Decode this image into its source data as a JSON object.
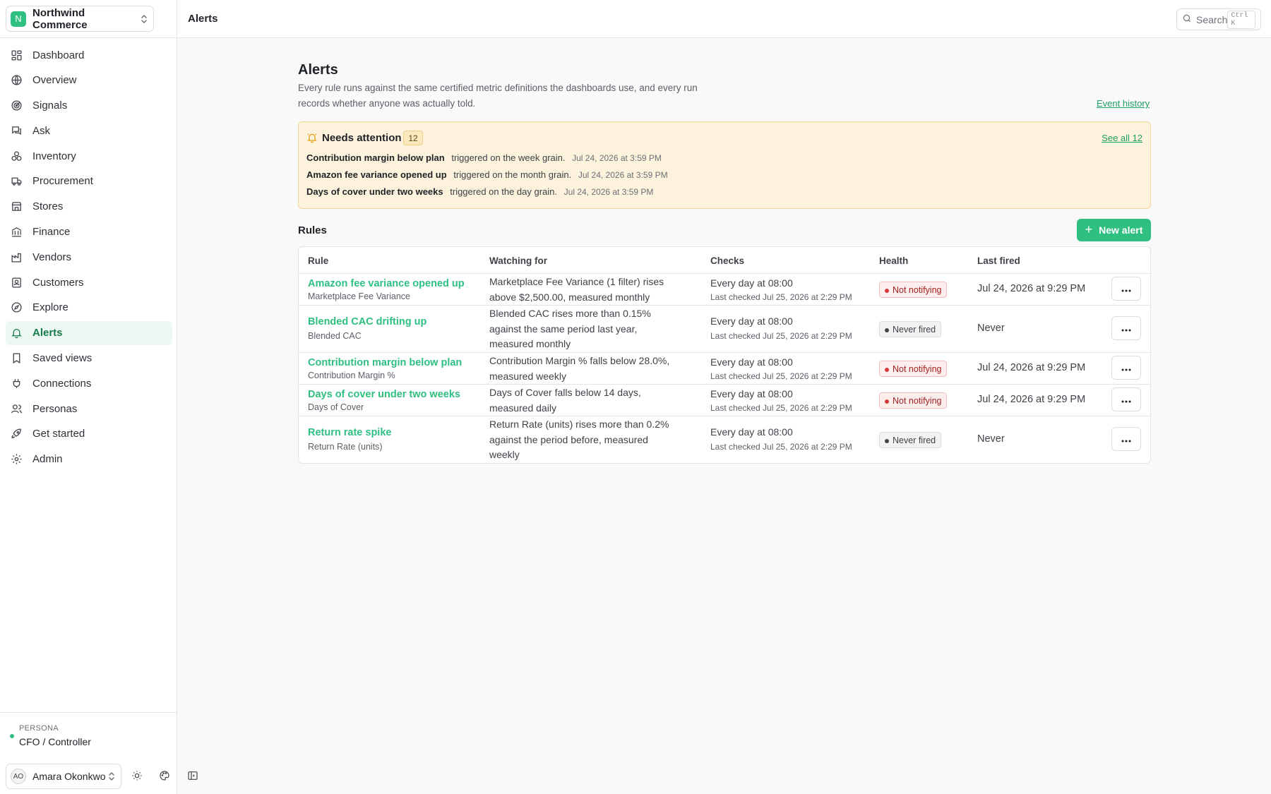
{
  "org": {
    "initial": "N",
    "name": "Northwind Commerce",
    "logo_color": "#2ebf81"
  },
  "topbar": {
    "title": "Alerts",
    "search_placeholder": "Search",
    "search_shortcut": "Ctrl K"
  },
  "sidebar": {
    "items": [
      {
        "label": "Dashboard",
        "icon": "dashboard-icon"
      },
      {
        "label": "Overview",
        "icon": "globe-icon"
      },
      {
        "label": "Signals",
        "icon": "radar-icon"
      },
      {
        "label": "Ask",
        "icon": "chat-icon"
      },
      {
        "label": "Inventory",
        "icon": "boxes-icon"
      },
      {
        "label": "Procurement",
        "icon": "truck-icon"
      },
      {
        "label": "Stores",
        "icon": "store-icon"
      },
      {
        "label": "Finance",
        "icon": "bank-icon"
      },
      {
        "label": "Vendors",
        "icon": "factory-icon"
      },
      {
        "label": "Customers",
        "icon": "contact-icon"
      },
      {
        "label": "Explore",
        "icon": "compass-icon"
      },
      {
        "label": "Alerts",
        "icon": "bell-icon",
        "active": true
      },
      {
        "label": "Saved views",
        "icon": "bookmark-icon"
      },
      {
        "label": "Connections",
        "icon": "plug-icon"
      },
      {
        "label": "Personas",
        "icon": "users-icon"
      },
      {
        "label": "Get started",
        "icon": "rocket-icon"
      },
      {
        "label": "Admin",
        "icon": "gear-icon"
      }
    ],
    "persona_label": "PERSONA",
    "persona_value": "CFO / Controller",
    "user_initials": "AO",
    "user_name": "Amara Okonkwo"
  },
  "page": {
    "title": "Alerts",
    "description": "Every rule runs against the same certified metric definitions the dashboards use, and every run records whether anyone was actually told.",
    "event_history": "Event history"
  },
  "attention": {
    "title": "Needs attention",
    "count": "12",
    "see_all": "See all 12",
    "items": [
      {
        "name": "Contribution margin below plan",
        "message": "triggered on the week grain.",
        "time": "Jul 24, 2026 at 3:59 PM"
      },
      {
        "name": "Amazon fee variance opened up",
        "message": "triggered on the month grain.",
        "time": "Jul 24, 2026 at 3:59 PM"
      },
      {
        "name": "Days of cover under two weeks",
        "message": "triggered on the day grain.",
        "time": "Jul 24, 2026 at 3:59 PM"
      }
    ]
  },
  "rules": {
    "label": "Rules",
    "new_alert": "New alert",
    "columns": [
      "Rule",
      "Watching for",
      "Checks",
      "Health",
      "Last fired"
    ],
    "rows": [
      {
        "name": "Amazon fee variance opened up",
        "metric": "Marketplace Fee Variance",
        "watching": "Marketplace Fee Variance (1 filter) rises above $2,500.00, measured monthly",
        "checks": "Every day at 08:00",
        "last_checked": "Last checked Jul 25, 2026 at 2:29 PM",
        "health": "Not notifying",
        "last_fired": "Jul 24, 2026 at 9:29 PM"
      },
      {
        "name": "Blended CAC drifting up",
        "metric": "Blended CAC",
        "watching": "Blended CAC rises more than 0.15% against the same period last year, measured monthly",
        "checks": "Every day at 08:00",
        "last_checked": "Last checked Jul 25, 2026 at 2:29 PM",
        "health": "Never fired",
        "last_fired": "Never"
      },
      {
        "name": "Contribution margin below plan",
        "metric": "Contribution Margin %",
        "watching": "Contribution Margin % falls below 28.0%, measured weekly",
        "checks": "Every day at 08:00",
        "last_checked": "Last checked Jul 25, 2026 at 2:29 PM",
        "health": "Not notifying",
        "last_fired": "Jul 24, 2026 at 9:29 PM"
      },
      {
        "name": "Days of cover under two weeks",
        "metric": "Days of Cover",
        "watching": "Days of Cover falls below 14 days, measured daily",
        "checks": "Every day at 08:00",
        "last_checked": "Last checked Jul 25, 2026 at 2:29 PM",
        "health": "Not notifying",
        "last_fired": "Jul 24, 2026 at 9:29 PM"
      },
      {
        "name": "Return rate spike",
        "metric": "Return Rate (units)",
        "watching": "Return Rate (units) rises more than 0.2% against the period before, measured weekly",
        "checks": "Every day at 08:00",
        "last_checked": "Last checked Jul 25, 2026 at 2:29 PM",
        "health": "Never fired",
        "last_fired": "Never"
      }
    ]
  },
  "colors": {
    "accent": "#2ebf81",
    "warning_bg": "#fdf2dc",
    "danger": "#d93838"
  }
}
